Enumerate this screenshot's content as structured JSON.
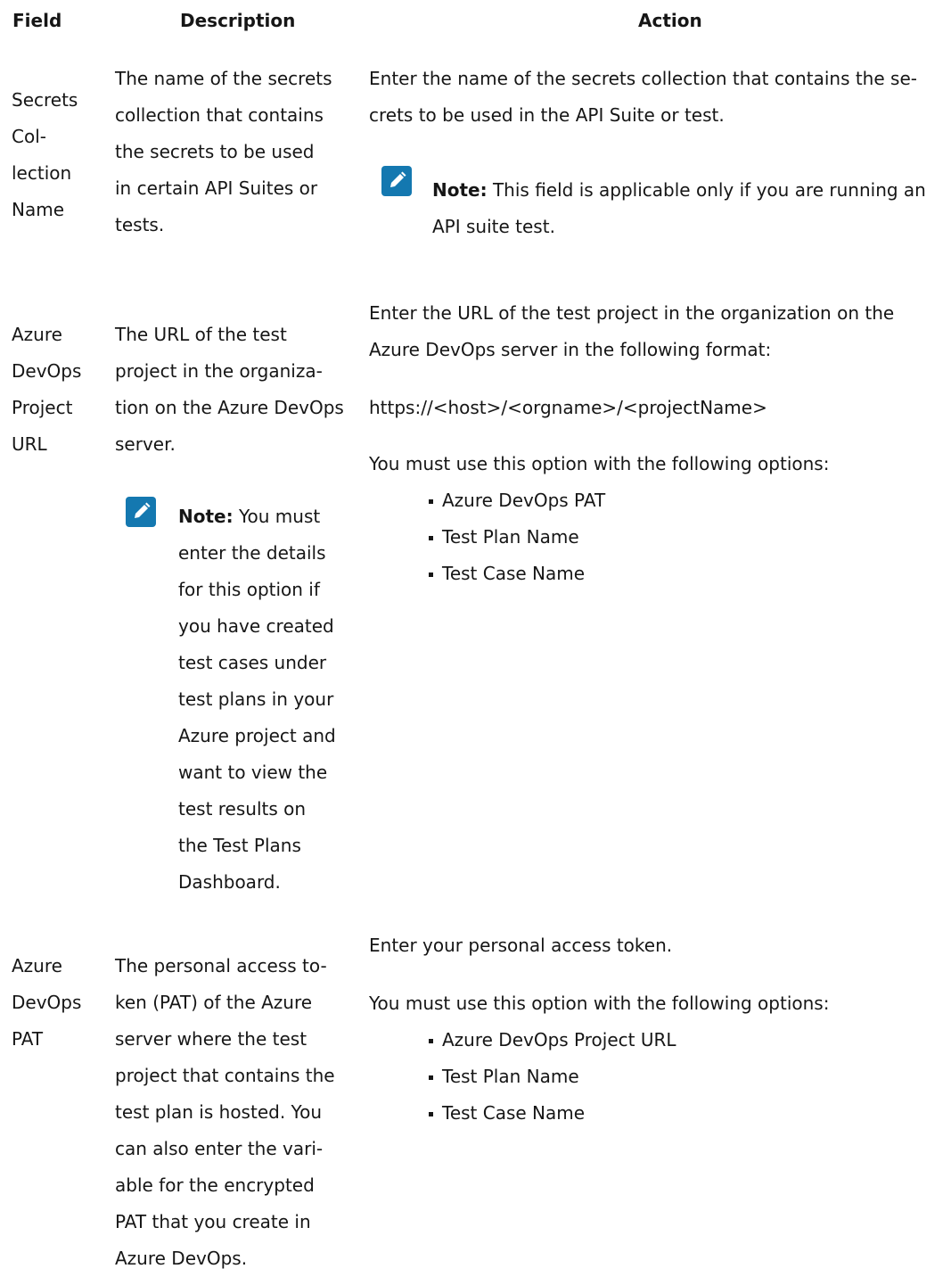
{
  "header": {
    "field": "Field",
    "description": "Description",
    "action": "Action"
  },
  "rows": [
    {
      "field_lines": [
        "Secrets",
        "Col-",
        "lection",
        "Name"
      ],
      "description_lines": [
        "The name of the secrets",
        "collection that contains",
        "the secrets to be used",
        "in certain API Suites or",
        "tests."
      ],
      "action_lines": [
        "Enter the name of the secrets collection that contains the se-",
        "crets to be used in the API Suite or test."
      ],
      "note": {
        "icon": "edit-pencil-icon",
        "label": "Note:",
        "first_line": " This field is applicable only if you are running an",
        "rest_lines": [
          "API suite test."
        ]
      }
    },
    {
      "field_lines": [
        "Azure",
        "DevOps",
        "Project",
        "URL"
      ],
      "description_lines": [
        "The URL of the test",
        "project in the organiza-",
        "tion on the Azure DevOps",
        "server."
      ],
      "description_note": {
        "icon": "edit-pencil-icon",
        "label": "Note:",
        "first_line": " You must",
        "rest_lines": [
          "enter the details",
          "for this option if",
          "you have created",
          "test cases under",
          "test plans in your",
          "Azure project and",
          "want to view the",
          "test results on",
          "the Test Plans",
          "Dashboard."
        ]
      },
      "action_lines": [
        "Enter the URL of the test project in the organization on the",
        "Azure DevOps server in the following format:"
      ],
      "action_format": "https://<host>/<orgname>/<projectName>",
      "action_must_use": "You must use this option with the following options:",
      "action_options": [
        "Azure DevOps PAT",
        "Test Plan Name",
        "Test Case Name"
      ]
    },
    {
      "field_lines": [
        "Azure",
        "DevOps",
        "PAT"
      ],
      "description_lines": [
        "The personal access to-",
        "ken (PAT) of the Azure",
        "server where the test",
        "project that contains the",
        "test plan is hosted. You",
        "can also enter the vari-",
        "able for the encrypted",
        "PAT that you create in",
        "Azure DevOps."
      ],
      "action_lines": [
        "Enter your personal access token."
      ],
      "action_must_use": "You must use this option with the following options:",
      "action_options": [
        "Azure DevOps Project URL",
        "Test Plan Name",
        "Test Case Name"
      ]
    }
  ],
  "colors": {
    "text": "#161616",
    "note_icon_bg": "#1478b0"
  }
}
